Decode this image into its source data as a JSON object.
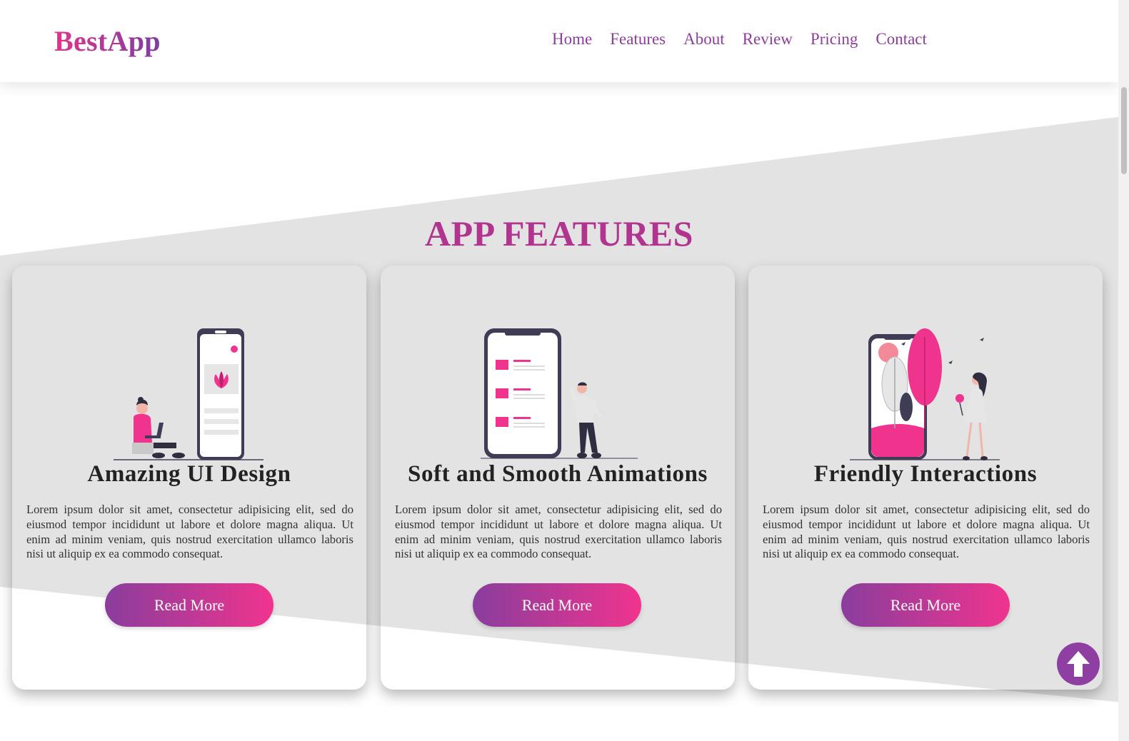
{
  "header": {
    "logo": "BestApp",
    "nav": [
      "Home",
      "Features",
      "About",
      "Review",
      "Pricing",
      "Contact"
    ]
  },
  "section": {
    "title": "APP FEATURES"
  },
  "cards": [
    {
      "title": "Amazing UI Design",
      "text": "Lorem ipsum dolor sit amet, consectetur adipisicing elit, sed do eiusmod tempor incididunt ut labore et dolore magna aliqua. Ut enim ad minim veniam, quis nostrud exercitation ullamco laboris nisi ut aliquip ex ea commodo consequat.",
      "button": "Read More",
      "illustration": "phone-with-seated-woman-illustration"
    },
    {
      "title": "Soft and Smooth Animations",
      "text": "Lorem ipsum dolor sit amet, consectetur adipisicing elit, sed do eiusmod tempor incididunt ut labore et dolore magna aliqua. Ut enim ad minim veniam, quis nostrud exercitation ullamco laboris nisi ut aliquip ex ea commodo consequat.",
      "button": "Read More",
      "illustration": "phone-list-with-standing-man-illustration"
    },
    {
      "title": "Friendly Interactions",
      "text": "Lorem ipsum dolor sit amet, consectetur adipisicing elit, sed do eiusmod tempor incididunt ut labore et dolore magna aliqua. Ut enim ad minim veniam, quis nostrud exercitation ullamco laboris nisi ut aliquip ex ea commodo consequat.",
      "button": "Read More",
      "illustration": "phone-tree-with-woman-illustration"
    }
  ],
  "scroll_top": {
    "icon": "arrow-up-icon"
  },
  "colors": {
    "accent_pink": "#f0348e",
    "accent_purple": "#8a3d9d",
    "title": "#b1358f",
    "band": "#e3e3e3"
  }
}
